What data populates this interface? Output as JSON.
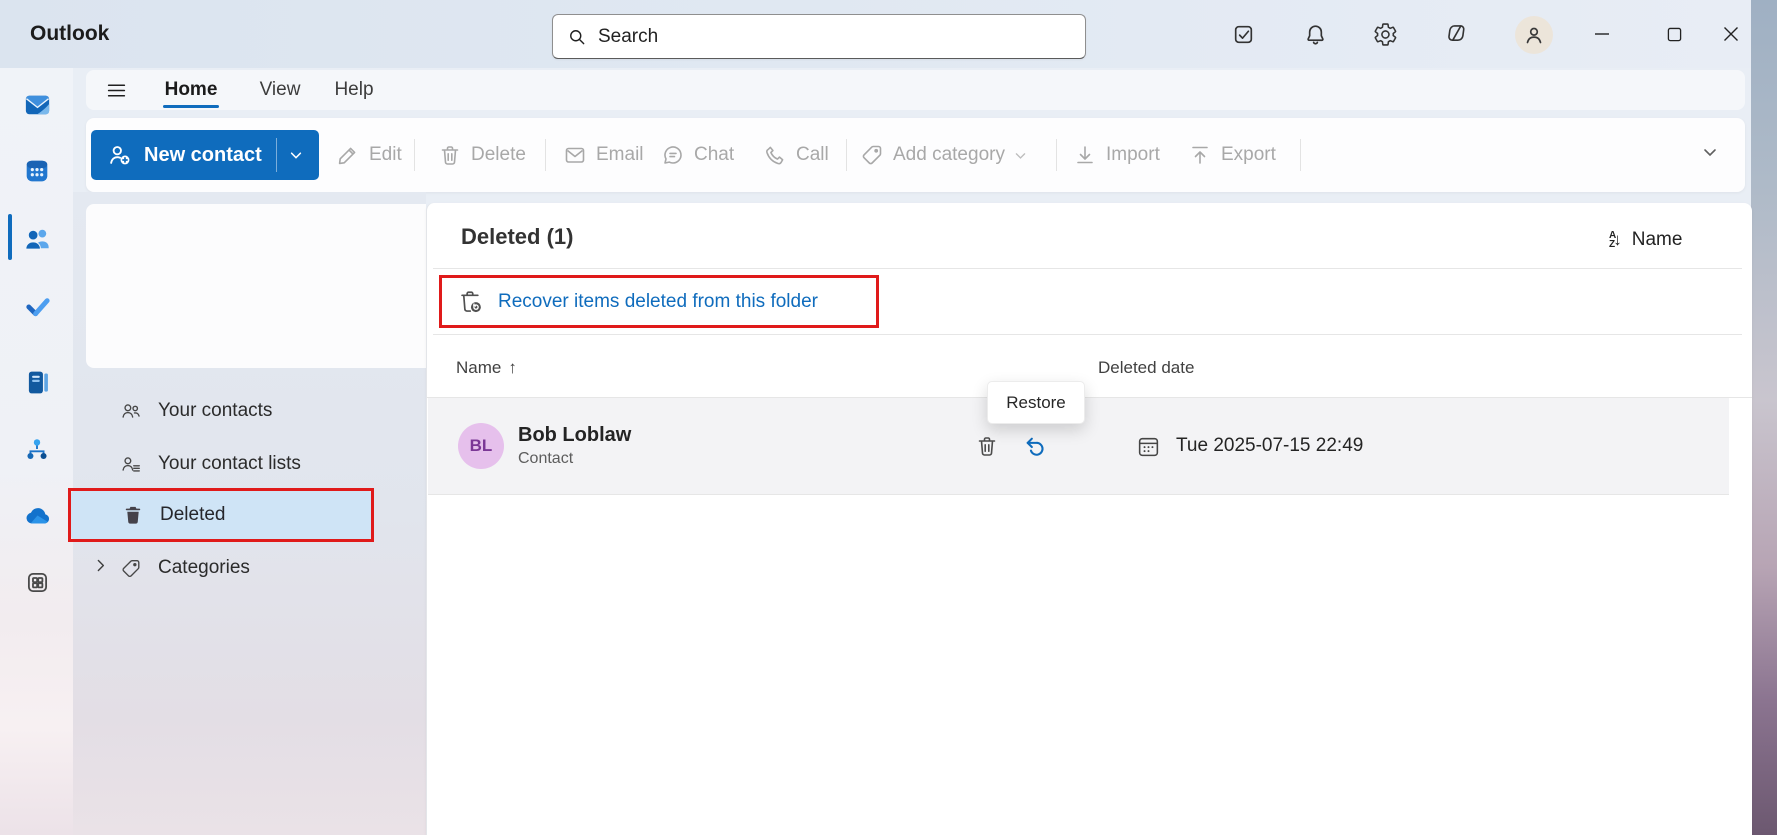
{
  "window": {
    "title": "Outlook"
  },
  "titlebar": {
    "search_placeholder": "Search"
  },
  "nav_tabs": {
    "items": [
      {
        "label": "Home",
        "active": true
      },
      {
        "label": "View",
        "active": false
      },
      {
        "label": "Help",
        "active": false
      }
    ]
  },
  "toolbar": {
    "new_contact_label": "New contact",
    "items": [
      {
        "label": "Edit"
      },
      {
        "label": "Delete"
      },
      {
        "label": "Email"
      },
      {
        "label": "Chat"
      },
      {
        "label": "Call"
      },
      {
        "label": "Add category"
      },
      {
        "label": "Import"
      },
      {
        "label": "Export"
      }
    ]
  },
  "rail": {
    "items": [
      "mail",
      "calendar",
      "people",
      "todo",
      "journal",
      "org-chart",
      "onedrive",
      "apps"
    ],
    "selected": "people"
  },
  "folder_pane": {
    "items": [
      {
        "label": "Your contacts",
        "selected": false
      },
      {
        "label": "Your contact lists",
        "selected": false
      },
      {
        "label": "Deleted",
        "selected": true,
        "annotated": true
      },
      {
        "label": "Categories",
        "selected": false,
        "expandable": true
      }
    ]
  },
  "content": {
    "title": "Deleted (1)",
    "sort": {
      "label": "Name"
    },
    "recover_link": "Recover items deleted from this folder",
    "columns": [
      {
        "label": "Name",
        "sorted": "asc"
      },
      {
        "label": "Deleted date"
      }
    ],
    "rows": [
      {
        "initials": "BL",
        "name": "Bob Loblaw",
        "kind": "Contact",
        "deleted_date": "Tue 2025-07-15 22:49"
      }
    ],
    "tooltip": "Restore"
  },
  "glyphs": {
    "arrow_up": "↑",
    "arrow_down": "↓",
    "letter_a": "A",
    "letter_z": "Z"
  },
  "colors": {
    "accent": "#0f6cbd",
    "annotation_red": "#e01a1a",
    "selected_item_bg": "#cfe4f6",
    "link": "#0f6cbd",
    "avatar_bg": "#e6c0ec",
    "avatar_text": "#7b3796",
    "disabled": "#a8a8a8"
  }
}
